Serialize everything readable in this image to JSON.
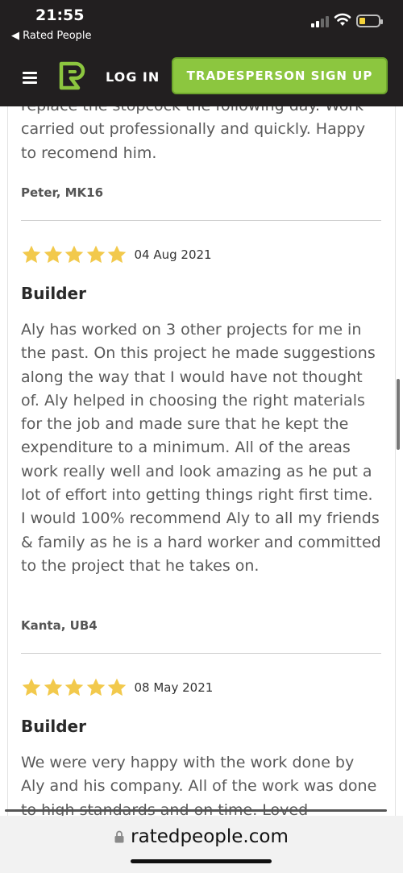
{
  "status_bar": {
    "time": "21:55",
    "back_app": "◀ Rated People"
  },
  "navbar": {
    "login_label": "LOG IN",
    "signup_label": "TRADESPERSON SIGN UP",
    "brand_color": "#8cc63f"
  },
  "reviews": [
    {
      "text": "replace the stopcock the following day. Work carried out professionally and quickly. Happy to recomend him.",
      "reviewer": "Peter, MK16"
    },
    {
      "rating": 5,
      "date": "04 Aug 2021",
      "trade": "Builder",
      "text": "Aly has worked on 3 other projects for me in the past. On this project he made suggestions along the way that I would have not thought of. Aly helped in choosing the right materials for the job and made sure that he kept the expenditure to a minimum. All of the areas work really well and look amazing as he put a lot of effort into getting things right first time. I would 100% recommend Aly to all my friends & family as he is a hard worker and committed to the project that he takes on.",
      "reviewer": "Kanta, UB4"
    },
    {
      "rating": 5,
      "date": "08 May 2021",
      "trade": "Builder",
      "text": "We were very happy with the work done by Aly and his company. All of the work was done to high standards and on time. Loved"
    }
  ],
  "browser": {
    "url": "ratedpeople.com"
  }
}
